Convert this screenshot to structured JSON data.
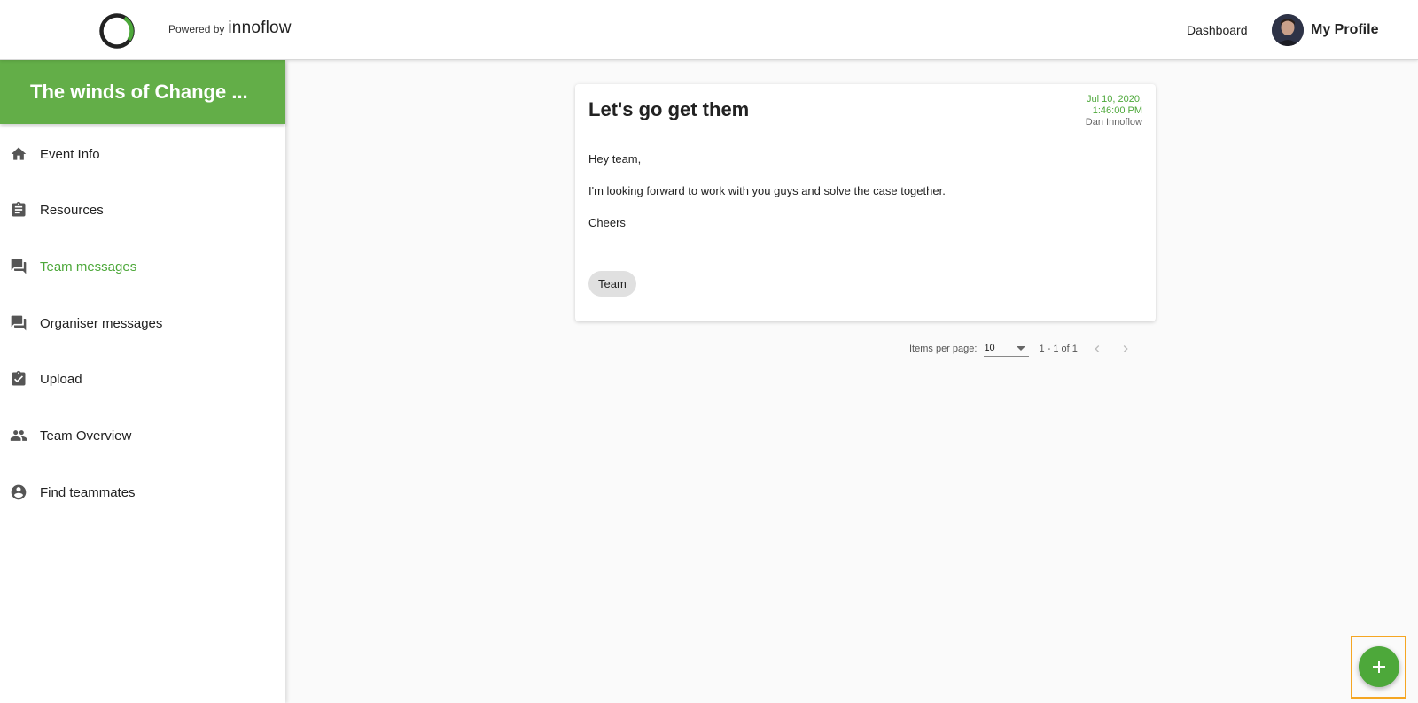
{
  "header": {
    "powered_by": "Powered by",
    "brand": "innoflow",
    "dashboard_label": "Dashboard",
    "profile_label": "My Profile"
  },
  "sidebar": {
    "event_title": "The winds of Change ...",
    "items": [
      {
        "label": "Event Info",
        "icon": "home-icon"
      },
      {
        "label": "Resources",
        "icon": "clipboard-icon"
      },
      {
        "label": "Team messages",
        "icon": "forum-icon",
        "active": true
      },
      {
        "label": "Organiser messages",
        "icon": "forum-icon"
      },
      {
        "label": "Upload",
        "icon": "clipboard-check-icon"
      },
      {
        "label": "Team Overview",
        "icon": "people-icon"
      },
      {
        "label": "Find teammates",
        "icon": "account-circle-icon"
      }
    ]
  },
  "message": {
    "title": "Let's go get them",
    "date_line1": "Jul 10, 2020,",
    "date_line2": "1:46:00 PM",
    "author": "Dan Innoflow",
    "body": [
      "Hey team,",
      "I'm looking forward to work with you guys and solve the case together.",
      "Cheers"
    ],
    "tag": "Team"
  },
  "paginator": {
    "items_per_page_label": "Items per page:",
    "items_per_page_value": "10",
    "range_label": "1 - 1 of 1"
  },
  "fab": {
    "icon": "plus-icon"
  },
  "colors": {
    "accent": "#63ae48",
    "accent_text": "#4da83a",
    "highlight": "#f5a623"
  }
}
